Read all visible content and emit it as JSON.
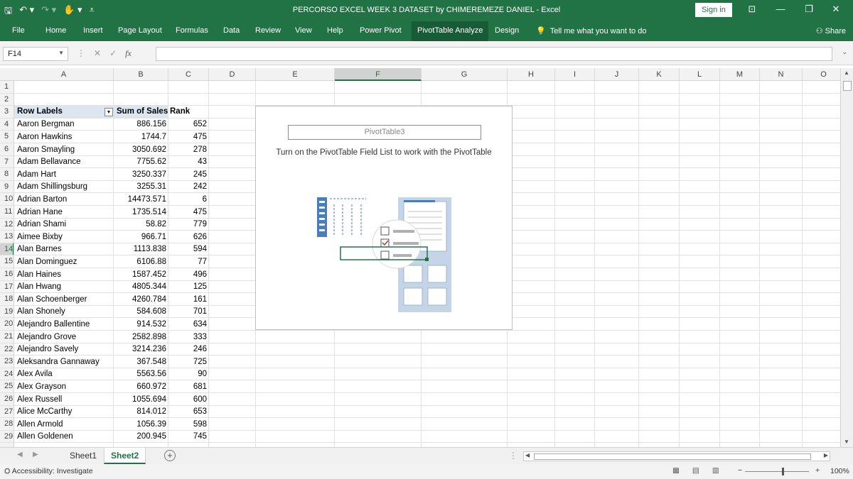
{
  "window": {
    "title": "PERCORSO EXCEL WEEK 3  DATASET by CHIMEREMEZE DANIEL  -  Excel",
    "sign_in": "Sign in"
  },
  "ribbon": {
    "tabs": [
      "File",
      "Home",
      "Insert",
      "Page Layout",
      "Formulas",
      "Data",
      "Review",
      "View",
      "Help",
      "Power Pivot",
      "PivotTable Analyze",
      "Design"
    ],
    "active_tab": "PivotTable Analyze",
    "tell_me": "Tell me what you want to do",
    "share": "Share"
  },
  "formula_bar": {
    "name_box": "F14",
    "fx_label": "fx",
    "formula": ""
  },
  "columns": [
    "A",
    "B",
    "C",
    "D",
    "E",
    "F",
    "G",
    "H",
    "I",
    "J",
    "K",
    "L",
    "M",
    "N",
    "O"
  ],
  "selected_column": "F",
  "row_numbers": [
    "1",
    "2",
    "3",
    "4",
    "5",
    "6",
    "7",
    "8",
    "9",
    "10",
    "11",
    "12",
    "13",
    "14",
    "15",
    "16",
    "17",
    "18",
    "19",
    "20",
    "21",
    "22",
    "23",
    "24",
    "25",
    "26",
    "27",
    "28",
    "29"
  ],
  "selected_row": "14",
  "pivot": {
    "header": {
      "row_labels": "Row Labels",
      "sum_of_sales": "Sum of Sales",
      "rank": "Rank"
    },
    "rows": [
      {
        "name": "Aaron Bergman",
        "sales": "886.156",
        "rank": "652"
      },
      {
        "name": "Aaron Hawkins",
        "sales": "1744.7",
        "rank": "475"
      },
      {
        "name": "Aaron Smayling",
        "sales": "3050.692",
        "rank": "278"
      },
      {
        "name": "Adam Bellavance",
        "sales": "7755.62",
        "rank": "43"
      },
      {
        "name": "Adam Hart",
        "sales": "3250.337",
        "rank": "245"
      },
      {
        "name": "Adam Shillingsburg",
        "sales": "3255.31",
        "rank": "242"
      },
      {
        "name": "Adrian Barton",
        "sales": "14473.571",
        "rank": "6"
      },
      {
        "name": "Adrian Hane",
        "sales": "1735.514",
        "rank": "475"
      },
      {
        "name": "Adrian Shami",
        "sales": "58.82",
        "rank": "779"
      },
      {
        "name": "Aimee Bixby",
        "sales": "966.71",
        "rank": "626"
      },
      {
        "name": "Alan Barnes",
        "sales": "1113.838",
        "rank": "594"
      },
      {
        "name": "Alan Dominguez",
        "sales": "6106.88",
        "rank": "77"
      },
      {
        "name": "Alan Haines",
        "sales": "1587.452",
        "rank": "496"
      },
      {
        "name": "Alan Hwang",
        "sales": "4805.344",
        "rank": "125"
      },
      {
        "name": "Alan Schoenberger",
        "sales": "4260.784",
        "rank": "161"
      },
      {
        "name": "Alan Shonely",
        "sales": "584.608",
        "rank": "701"
      },
      {
        "name": "Alejandro Ballentine",
        "sales": "914.532",
        "rank": "634"
      },
      {
        "name": "Alejandro Grove",
        "sales": "2582.898",
        "rank": "333"
      },
      {
        "name": "Alejandro Savely",
        "sales": "3214.236",
        "rank": "246"
      },
      {
        "name": "Aleksandra Gannaway",
        "sales": "367.548",
        "rank": "725"
      },
      {
        "name": "Alex Avila",
        "sales": "5563.56",
        "rank": "90"
      },
      {
        "name": "Alex Grayson",
        "sales": "660.972",
        "rank": "681"
      },
      {
        "name": "Alex Russell",
        "sales": "1055.694",
        "rank": "600"
      },
      {
        "name": "Alice McCarthy",
        "sales": "814.012",
        "rank": "653"
      },
      {
        "name": "Allen Armold",
        "sales": "1056.39",
        "rank": "598"
      },
      {
        "name": "Allen Goldenen",
        "sales": "200.945",
        "rank": "745"
      }
    ],
    "placeholder_name": "PivotTable3",
    "placeholder_message": "Turn on the PivotTable Field List to work with the PivotTable"
  },
  "sheets": {
    "tabs": [
      "Sheet1",
      "Sheet2"
    ],
    "active": "Sheet2"
  },
  "status": {
    "accessibility": "Accessibility: Investigate",
    "zoom": "100%"
  },
  "colors": {
    "excel_green": "#217346",
    "header_fill": "#dce6f1"
  }
}
